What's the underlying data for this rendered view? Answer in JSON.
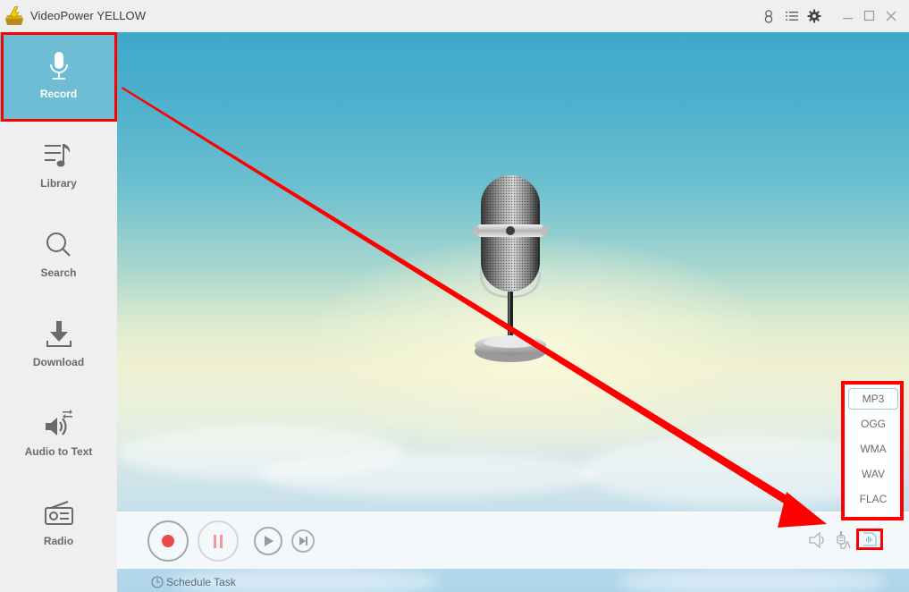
{
  "app": {
    "title": "VideoPower YELLOW"
  },
  "titlebar": {
    "icons": [
      "user-icon",
      "menu-list-icon",
      "settings-gear-icon",
      "minimize-icon",
      "maximize-icon",
      "close-icon"
    ]
  },
  "sidebar": {
    "items": [
      {
        "label": "Record",
        "icon": "microphone-icon",
        "active": true
      },
      {
        "label": "Library",
        "icon": "music-library-icon",
        "active": false
      },
      {
        "label": "Search",
        "icon": "search-icon",
        "active": false
      },
      {
        "label": "Download",
        "icon": "download-icon",
        "active": false
      },
      {
        "label": "Audio to Text",
        "icon": "audio-to-text-icon",
        "active": false
      },
      {
        "label": "Radio",
        "icon": "radio-icon",
        "active": false
      }
    ]
  },
  "controls": {
    "record": "record-icon",
    "pause": "pause-icon",
    "play": "play-icon",
    "next": "skip-next-icon",
    "schedule_label": "Schedule Task"
  },
  "format_menu": {
    "selected": "MP3",
    "options": [
      "MP3",
      "OGG",
      "WMA",
      "WAV",
      "FLAC"
    ]
  },
  "colors": {
    "accent": "#6fbdd4",
    "annotation": "#ff0000",
    "record": "#e94a4a"
  }
}
